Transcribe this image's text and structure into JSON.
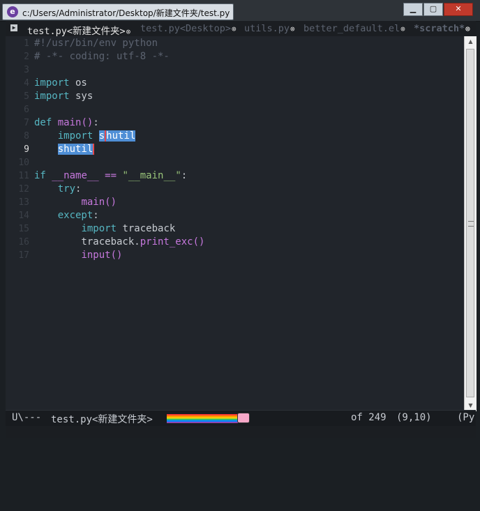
{
  "window": {
    "title": "c:/Users/Administrator/Desktop/新建文件夹/test.py",
    "app_icon": "emacs-icon",
    "buttons": {
      "minimize": "▁",
      "maximize": "▢",
      "close": "✕"
    }
  },
  "tabs": [
    {
      "label": "test.py<新建文件夹>",
      "close": "⊗",
      "active": true
    },
    {
      "label": "test.py<Desktop>",
      "close": "⊗",
      "active": false
    },
    {
      "label": "utils.py",
      "close": "⊗",
      "active": false
    },
    {
      "label": "better_default.el",
      "close": "⊗",
      "active": false
    },
    {
      "label": "*scratch*",
      "close": "⊗",
      "active": false
    }
  ],
  "editor": {
    "lines": [
      {
        "n": "1",
        "text": "#!/usr/bin/env python"
      },
      {
        "n": "2",
        "text": "# -*- coding: utf-8 -*-"
      },
      {
        "n": "3",
        "text": ""
      },
      {
        "n": "4",
        "text": "import os"
      },
      {
        "n": "5",
        "text": "import sys"
      },
      {
        "n": "6",
        "text": ""
      },
      {
        "n": "7",
        "text": "def main():"
      },
      {
        "n": "8",
        "text": "    import shutil"
      },
      {
        "n": "9",
        "text": "    shutil"
      },
      {
        "n": "10",
        "text": ""
      },
      {
        "n": "11",
        "text": "if __name__ == \"__main__\":"
      },
      {
        "n": "12",
        "text": "    try:"
      },
      {
        "n": "13",
        "text": "        main()"
      },
      {
        "n": "14",
        "text": "    except:"
      },
      {
        "n": "15",
        "text": "        import traceback"
      },
      {
        "n": "16",
        "text": "        traceback.print_exc()"
      },
      {
        "n": "17",
        "text": "        input()"
      }
    ],
    "current_line": 9
  },
  "modeline": {
    "state": "U\\---",
    "buffer": "test.py<新建文件夹>",
    "position": "of 249",
    "cursor": "(9,10)",
    "mode": "(Py"
  }
}
